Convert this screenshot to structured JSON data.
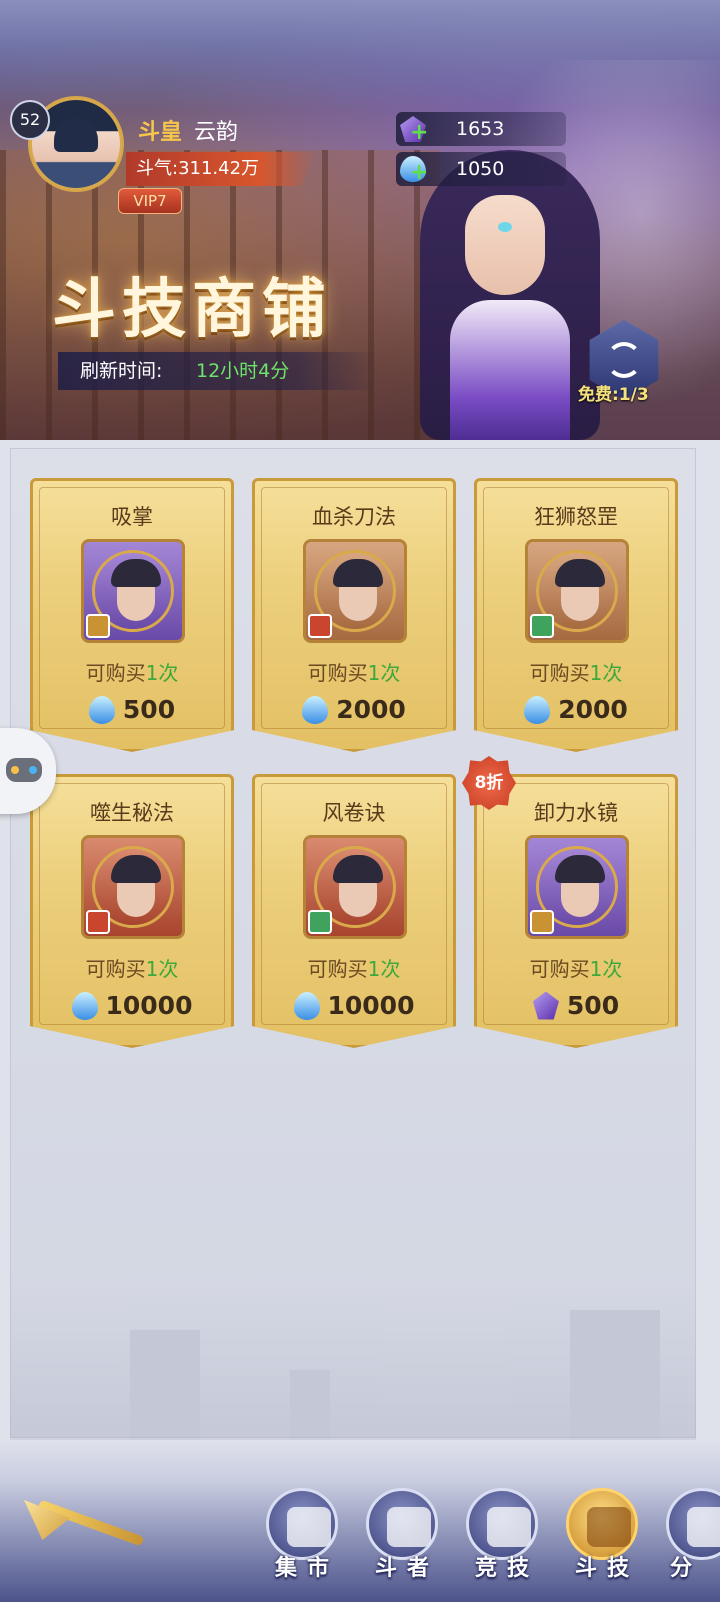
{
  "player": {
    "level": "52",
    "rank": "斗皇",
    "name": "云韵",
    "power": "斗气:311.42万",
    "vip": "VIP7"
  },
  "currencies": [
    {
      "icon": "purple-crystal-icon",
      "value": "1653"
    },
    {
      "icon": "blue-droplet-icon",
      "value": "1050"
    }
  ],
  "shop": {
    "title": "斗技商铺",
    "refresh_label": "刷新时间:",
    "refresh_time": "12小时4分",
    "free_refresh": "免费:1/3"
  },
  "items": [
    {
      "name": "吸掌",
      "limit_prefix": "可购买",
      "limit_count": "1次",
      "price": "500",
      "currency": "blue-droplet-icon",
      "frame": "purple",
      "element": "gold"
    },
    {
      "name": "血杀刀法",
      "limit_prefix": "可购买",
      "limit_count": "1次",
      "price": "2000",
      "currency": "blue-droplet-icon",
      "frame": "brown",
      "element": "red"
    },
    {
      "name": "狂狮怒罡",
      "limit_prefix": "可购买",
      "limit_count": "1次",
      "price": "2000",
      "currency": "blue-droplet-icon",
      "frame": "brown",
      "element": "green"
    },
    {
      "name": "噬生秘法",
      "limit_prefix": "可购买",
      "limit_count": "1次",
      "price": "10000",
      "currency": "blue-droplet-icon",
      "frame": "red",
      "element": "red"
    },
    {
      "name": "风卷诀",
      "limit_prefix": "可购买",
      "limit_count": "1次",
      "price": "10000",
      "currency": "blue-droplet-icon",
      "frame": "red",
      "element": "green"
    },
    {
      "name": "卸力水镜",
      "limit_prefix": "可购买",
      "limit_count": "1次",
      "price": "500",
      "currency": "purple-crystal-icon",
      "frame": "purple",
      "element": "gold",
      "discount": "8折"
    }
  ],
  "nav": [
    {
      "label": "集市",
      "icon": "market-stall-icon"
    },
    {
      "label": "斗者",
      "icon": "fighter-icon"
    },
    {
      "label": "竞技",
      "icon": "crossed-swords-icon"
    },
    {
      "label": "斗技",
      "icon": "scroll-icon",
      "active": true
    },
    {
      "label": "分",
      "icon": "share-icon"
    }
  ],
  "colors": {
    "card_gold": "#eccf7c",
    "limit_green": "#3ea83a",
    "refresh_time_green": "#6ee36a",
    "rank_gold": "#f7c64a",
    "nav_blue": "#39407a"
  }
}
